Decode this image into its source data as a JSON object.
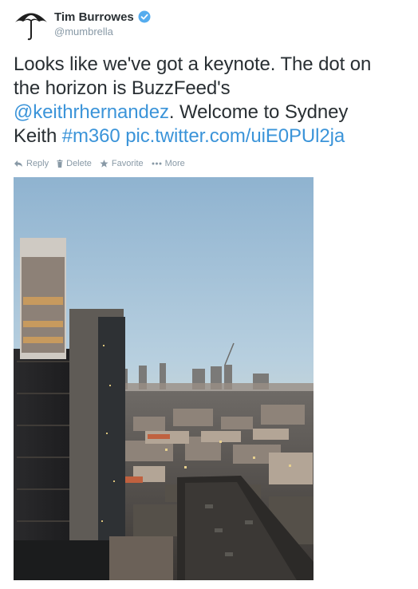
{
  "user": {
    "name": "Tim Burrowes",
    "handle": "@mumbrella"
  },
  "tweet": {
    "text_1": "Looks like we've got a keynote. The dot on",
    "text_2": "the horizon is BuzzFeed's",
    "mention": "@keithrhernandez",
    "text_3": ". Welcome to Sydney",
    "text_4": "Keith ",
    "hashtag": "#m360",
    "pic_link": "pic.twitter.com/uiE0PUl2ja"
  },
  "actions": {
    "reply": "Reply",
    "delete": "Delete",
    "favorite": "Favorite",
    "more": "More"
  },
  "colors": {
    "link": "#3b94d9",
    "muted": "#8899a6",
    "verified": "#55acee"
  },
  "icons": [
    "umbrella-avatar",
    "verified-badge-icon",
    "reply-icon",
    "trash-icon",
    "star-icon",
    "ellipsis-icon"
  ]
}
